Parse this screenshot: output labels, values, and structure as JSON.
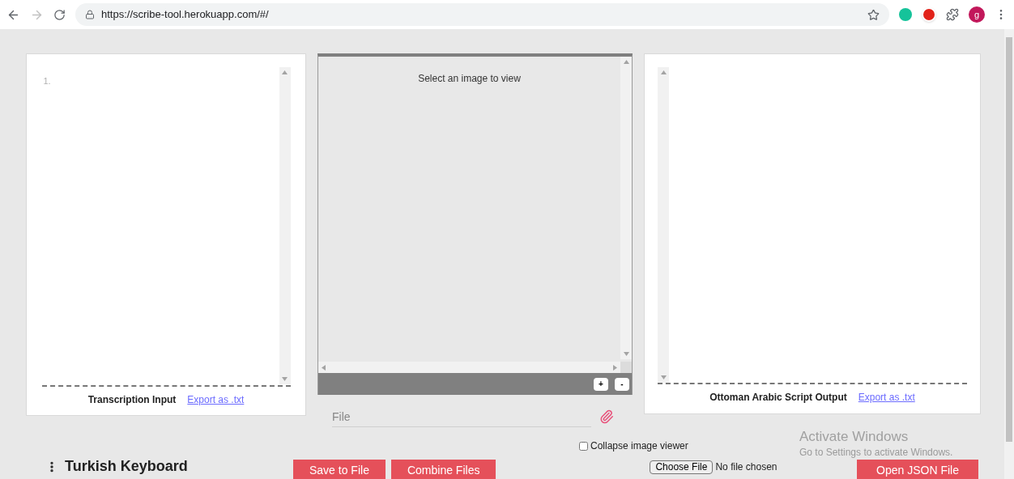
{
  "browser": {
    "url": "https://scribe-tool.herokuapp.com/#/",
    "avatar_letter": "g"
  },
  "transcription_panel": {
    "line_number": "1.",
    "title": "Transcription Input",
    "export_link": "Export as .txt"
  },
  "image_viewer": {
    "message": "Select an image to view",
    "zoom_in": "+",
    "zoom_out": "-",
    "file_placeholder": "File"
  },
  "output_panel": {
    "title": "Ottoman Arabic Script Output",
    "export_link": "Export as .txt"
  },
  "collapse_image_viewer": {
    "label": "Collapse image viewer",
    "checked": false
  },
  "keyboard": {
    "title": "Turkish Keyboard"
  },
  "buttons": [
    "Save to File",
    "Combine Files"
  ],
  "file_input": {
    "button": "Choose File",
    "status": "No file chosen"
  },
  "open_button": "Open JSON File",
  "os_notice": {
    "title": "Activate Windows",
    "text": "Go to Settings to activate Windows."
  }
}
